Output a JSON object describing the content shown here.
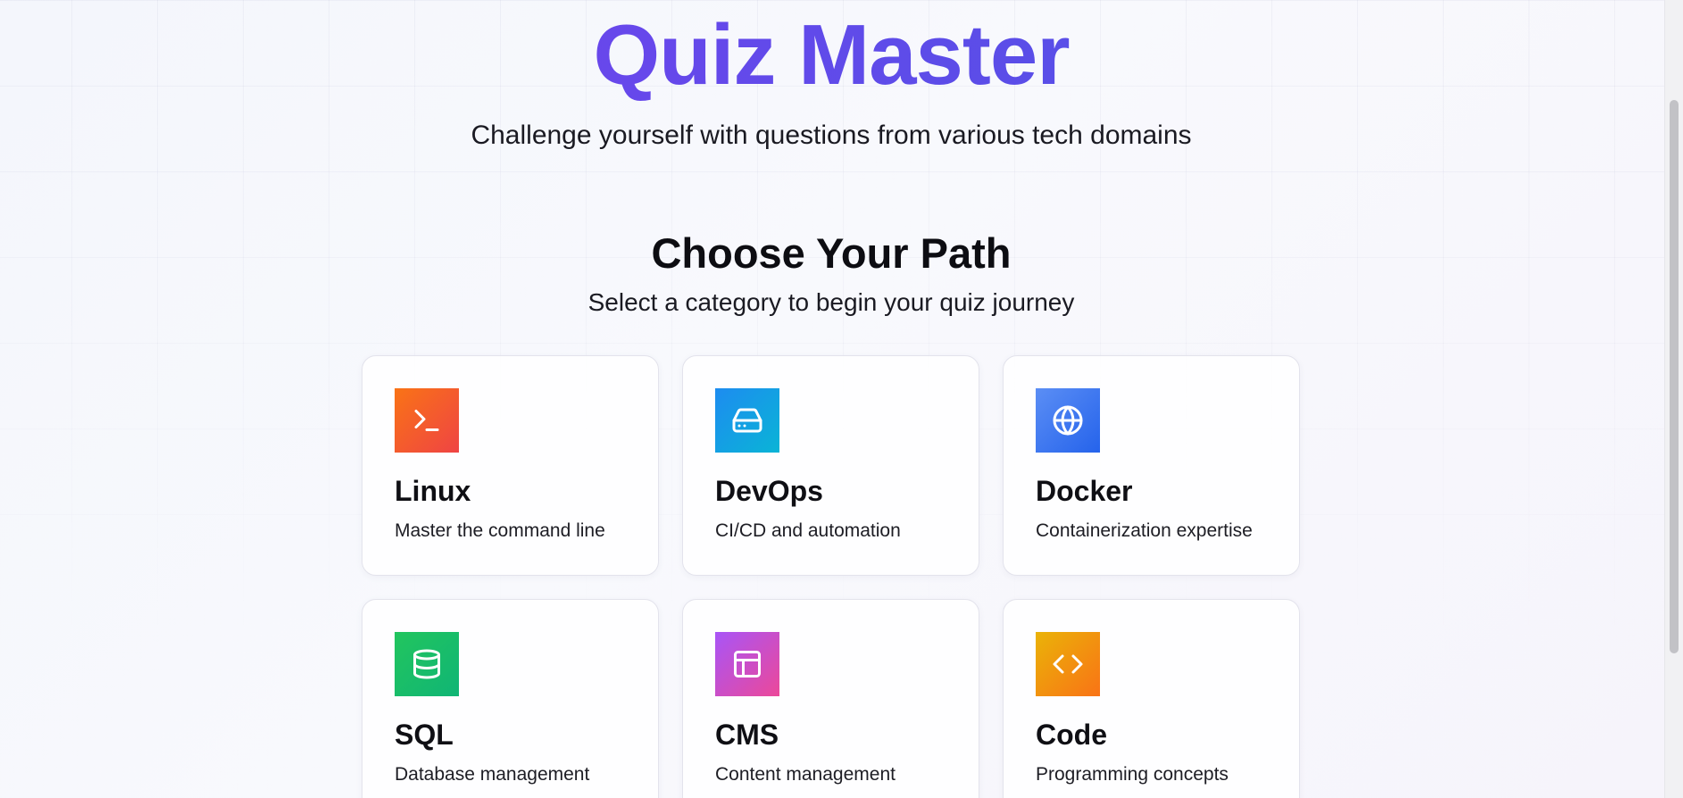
{
  "hero": {
    "title": "Quiz Master",
    "subtitle": "Challenge yourself with questions from various tech domains"
  },
  "section": {
    "title": "Choose Your Path",
    "subtitle": "Select a category to begin your quiz journey"
  },
  "categories": [
    {
      "title": "Linux",
      "description": "Master the command line",
      "icon": "terminal-icon",
      "colors": [
        "#f97316",
        "#ef4444"
      ]
    },
    {
      "title": "DevOps",
      "description": "CI/CD and automation",
      "icon": "server-drive-icon",
      "colors": [
        "#1d8cf0",
        "#0ab4d6"
      ]
    },
    {
      "title": "Docker",
      "description": "Containerization expertise",
      "icon": "globe-icon",
      "colors": [
        "#5b8ef5",
        "#2563eb"
      ]
    },
    {
      "title": "SQL",
      "description": "Database management",
      "icon": "database-icon",
      "colors": [
        "#22c55e",
        "#10b575"
      ]
    },
    {
      "title": "CMS",
      "description": "Content management",
      "icon": "layout-icon",
      "colors": [
        "#a855f7",
        "#ec4899"
      ]
    },
    {
      "title": "Code",
      "description": "Programming concepts",
      "icon": "code-icon",
      "colors": [
        "#eab308",
        "#f97316"
      ]
    }
  ]
}
